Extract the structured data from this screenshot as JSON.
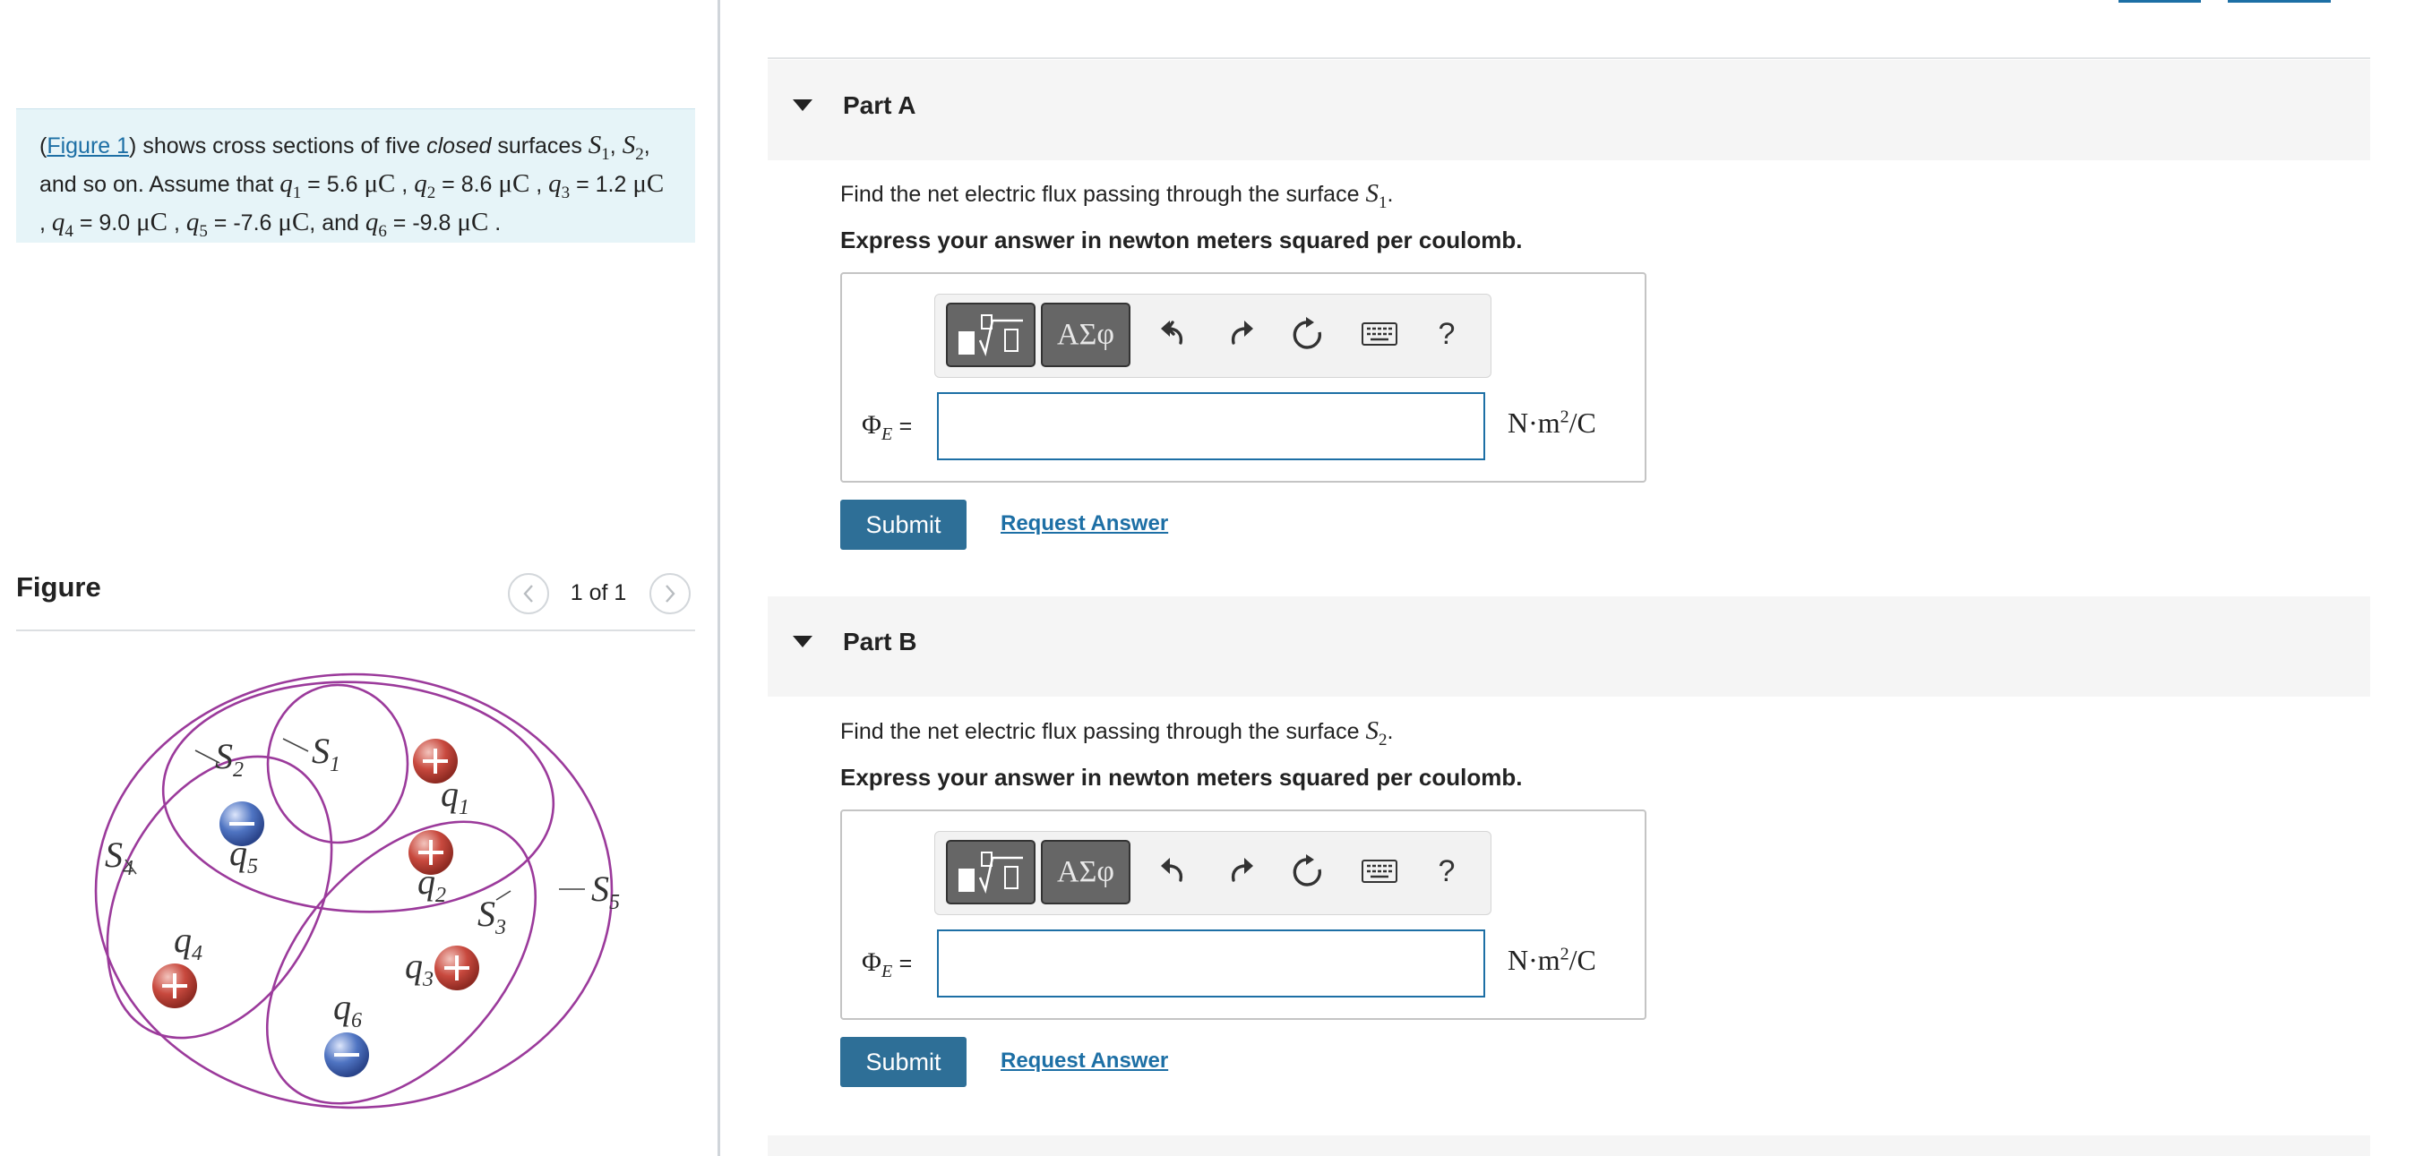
{
  "problem": {
    "figure_link": "Figure 1",
    "text_1": "shows cross sections of five",
    "text_closed": "closed",
    "text_2": "surfaces",
    "text_3": "and so on. Assume that",
    "and_text": ", and",
    "q1_value": "5.6",
    "q2_value": "8.6",
    "q3_value": "1.2",
    "q4_value": "9.0",
    "q5_value": "-7.6",
    "q6_value": "-9.8",
    "unit": "μC"
  },
  "figure_panel": {
    "title": "Figure",
    "pager": "1 of 1"
  },
  "figure_labels": {
    "S": "S",
    "q": "q",
    "s1": "1",
    "s2": "2",
    "s3": "3",
    "s4": "4",
    "s5": "5",
    "q1": "1",
    "q2": "2",
    "q3": "3",
    "q4": "4",
    "q5": "5",
    "q6": "6"
  },
  "parts": [
    {
      "title": "Part A",
      "question_prefix": "Find the net electric flux passing through the surface",
      "surface": "S",
      "surface_sub": "1",
      "instruction": "Express your answer in newton meters squared per coulomb.",
      "answer_label": "Φ",
      "answer_label_sub": "E",
      "answer_eq": "=",
      "answer_value": "",
      "units": "N·m",
      "units_sup": "2",
      "units_tail": "/C",
      "submit": "Submit",
      "request": "Request Answer"
    },
    {
      "title": "Part B",
      "question_prefix": "Find the net electric flux passing through the surface",
      "surface": "S",
      "surface_sub": "2",
      "instruction": "Express your answer in newton meters squared per coulomb.",
      "answer_label": "Φ",
      "answer_label_sub": "E",
      "answer_eq": "=",
      "answer_value": "",
      "units": "N·m",
      "units_sup": "2",
      "units_tail": "/C",
      "submit": "Submit",
      "request": "Request Answer"
    }
  ],
  "toolbar": {
    "greek_label": "ΑΣφ",
    "help_label": "?"
  },
  "colors": {
    "accent": "#1d6fa5",
    "submit_bg": "#2e6f97",
    "problem_bg": "#e6f4f8",
    "surface_curve": "#9b3a9b",
    "positive_charge": "#c8493e",
    "negative_charge": "#4f74c2"
  },
  "icons": [
    "chevron-left-icon",
    "chevron-right-icon",
    "caret-down-icon",
    "templates-icon",
    "undo-icon",
    "redo-icon",
    "reset-icon",
    "keyboard-icon",
    "help-icon"
  ]
}
